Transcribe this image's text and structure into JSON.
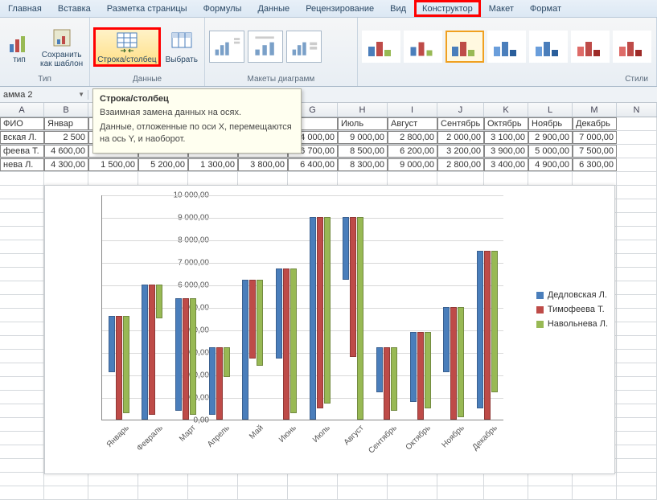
{
  "ribbon": {
    "tabs": [
      "Главная",
      "Вставка",
      "Разметка страницы",
      "Формулы",
      "Данные",
      "Рецензирование",
      "Вид",
      "Конструктор",
      "Макет",
      "Формат"
    ],
    "active_tab": "Конструктор",
    "groups": {
      "type": {
        "label": "Тип",
        "buttons": {
          "change_type": "тип",
          "save_template": "Сохранить\nкак шаблон"
        }
      },
      "data": {
        "label": "Данные",
        "buttons": {
          "switch_rowcol": "Строка/столбец",
          "select_data": "Выбрать"
        }
      },
      "layouts": {
        "label": "Макеты диаграмм"
      },
      "styles": {
        "label": "Стили"
      }
    }
  },
  "namebox": {
    "value": "амма 2"
  },
  "tooltip": {
    "title": "Строка/столбец",
    "line1": "Взаимная замена данных на осях.",
    "line2": "Данные, отложенные по оси X, перемещаются на ось Y, и наоборот."
  },
  "sheet": {
    "columns": [
      "A",
      "B",
      "C",
      "D",
      "E",
      "F",
      "G",
      "H",
      "I",
      "J",
      "K",
      "L",
      "M",
      "N"
    ],
    "headers_row": [
      "ФИО",
      "Январ",
      "",
      "",
      "",
      "",
      "",
      "Июль",
      "Август",
      "Сентябрь",
      "Октябрь",
      "Ноябрь",
      "Декабрь",
      ""
    ],
    "rows": [
      {
        "label": "вская Л.",
        "cells": [
          "2 500",
          "",
          "",
          "",
          "",
          "4 000,00",
          "9 000,00",
          "2 800,00",
          "2 000,00",
          "3 100,00",
          "2 900,00",
          "7 000,00"
        ]
      },
      {
        "label": "феева Т.",
        "cells": [
          "4 600,00",
          "",
          "",
          "",
          "",
          "6 700,00",
          "8 500,00",
          "6 200,00",
          "3 200,00",
          "3 900,00",
          "5 000,00",
          "7 500,00"
        ]
      },
      {
        "label": "нева Л.",
        "cells": [
          "4 300,00",
          "1 500,00",
          "5 200,00",
          "1 300,00",
          "3 800,00",
          "6 400,00",
          "8 300,00",
          "9 000,00",
          "2 800,00",
          "3 400,00",
          "4 900,00",
          "6 300,00"
        ]
      }
    ]
  },
  "chart_data": {
    "type": "bar",
    "title": "",
    "xlabel": "",
    "ylabel": "",
    "ylim": [
      0,
      10000
    ],
    "ytick_interval": 1000,
    "yticks": [
      "0,00",
      "1 000,00",
      "2 000,00",
      "3 000,00",
      "4 000,00",
      "5 000,00",
      "6 000,00",
      "7 000,00",
      "8 000,00",
      "9 000,00",
      "10 000,00"
    ],
    "categories": [
      "Январь",
      "Февраль",
      "Март",
      "Апрель",
      "Май",
      "Июнь",
      "Июль",
      "Август",
      "Сентябрь",
      "Октябрь",
      "Ноябрь",
      "Декабрь"
    ],
    "series": [
      {
        "name": "Дедловская Л.",
        "color": "#4a7ebb",
        "values": [
          2500,
          6000,
          5000,
          3000,
          6200,
          4000,
          9000,
          2800,
          2000,
          3100,
          2900,
          7000
        ]
      },
      {
        "name": "Тимофеева Т.",
        "color": "#be4b48",
        "values": [
          4600,
          5800,
          5400,
          3200,
          3500,
          6700,
          8500,
          6200,
          3200,
          3900,
          5000,
          7500
        ]
      },
      {
        "name": "Навольнева Л.",
        "color": "#98b954",
        "values": [
          4300,
          1500,
          5200,
          1300,
          3800,
          6400,
          8300,
          9000,
          2800,
          3400,
          4900,
          6300
        ]
      }
    ]
  }
}
